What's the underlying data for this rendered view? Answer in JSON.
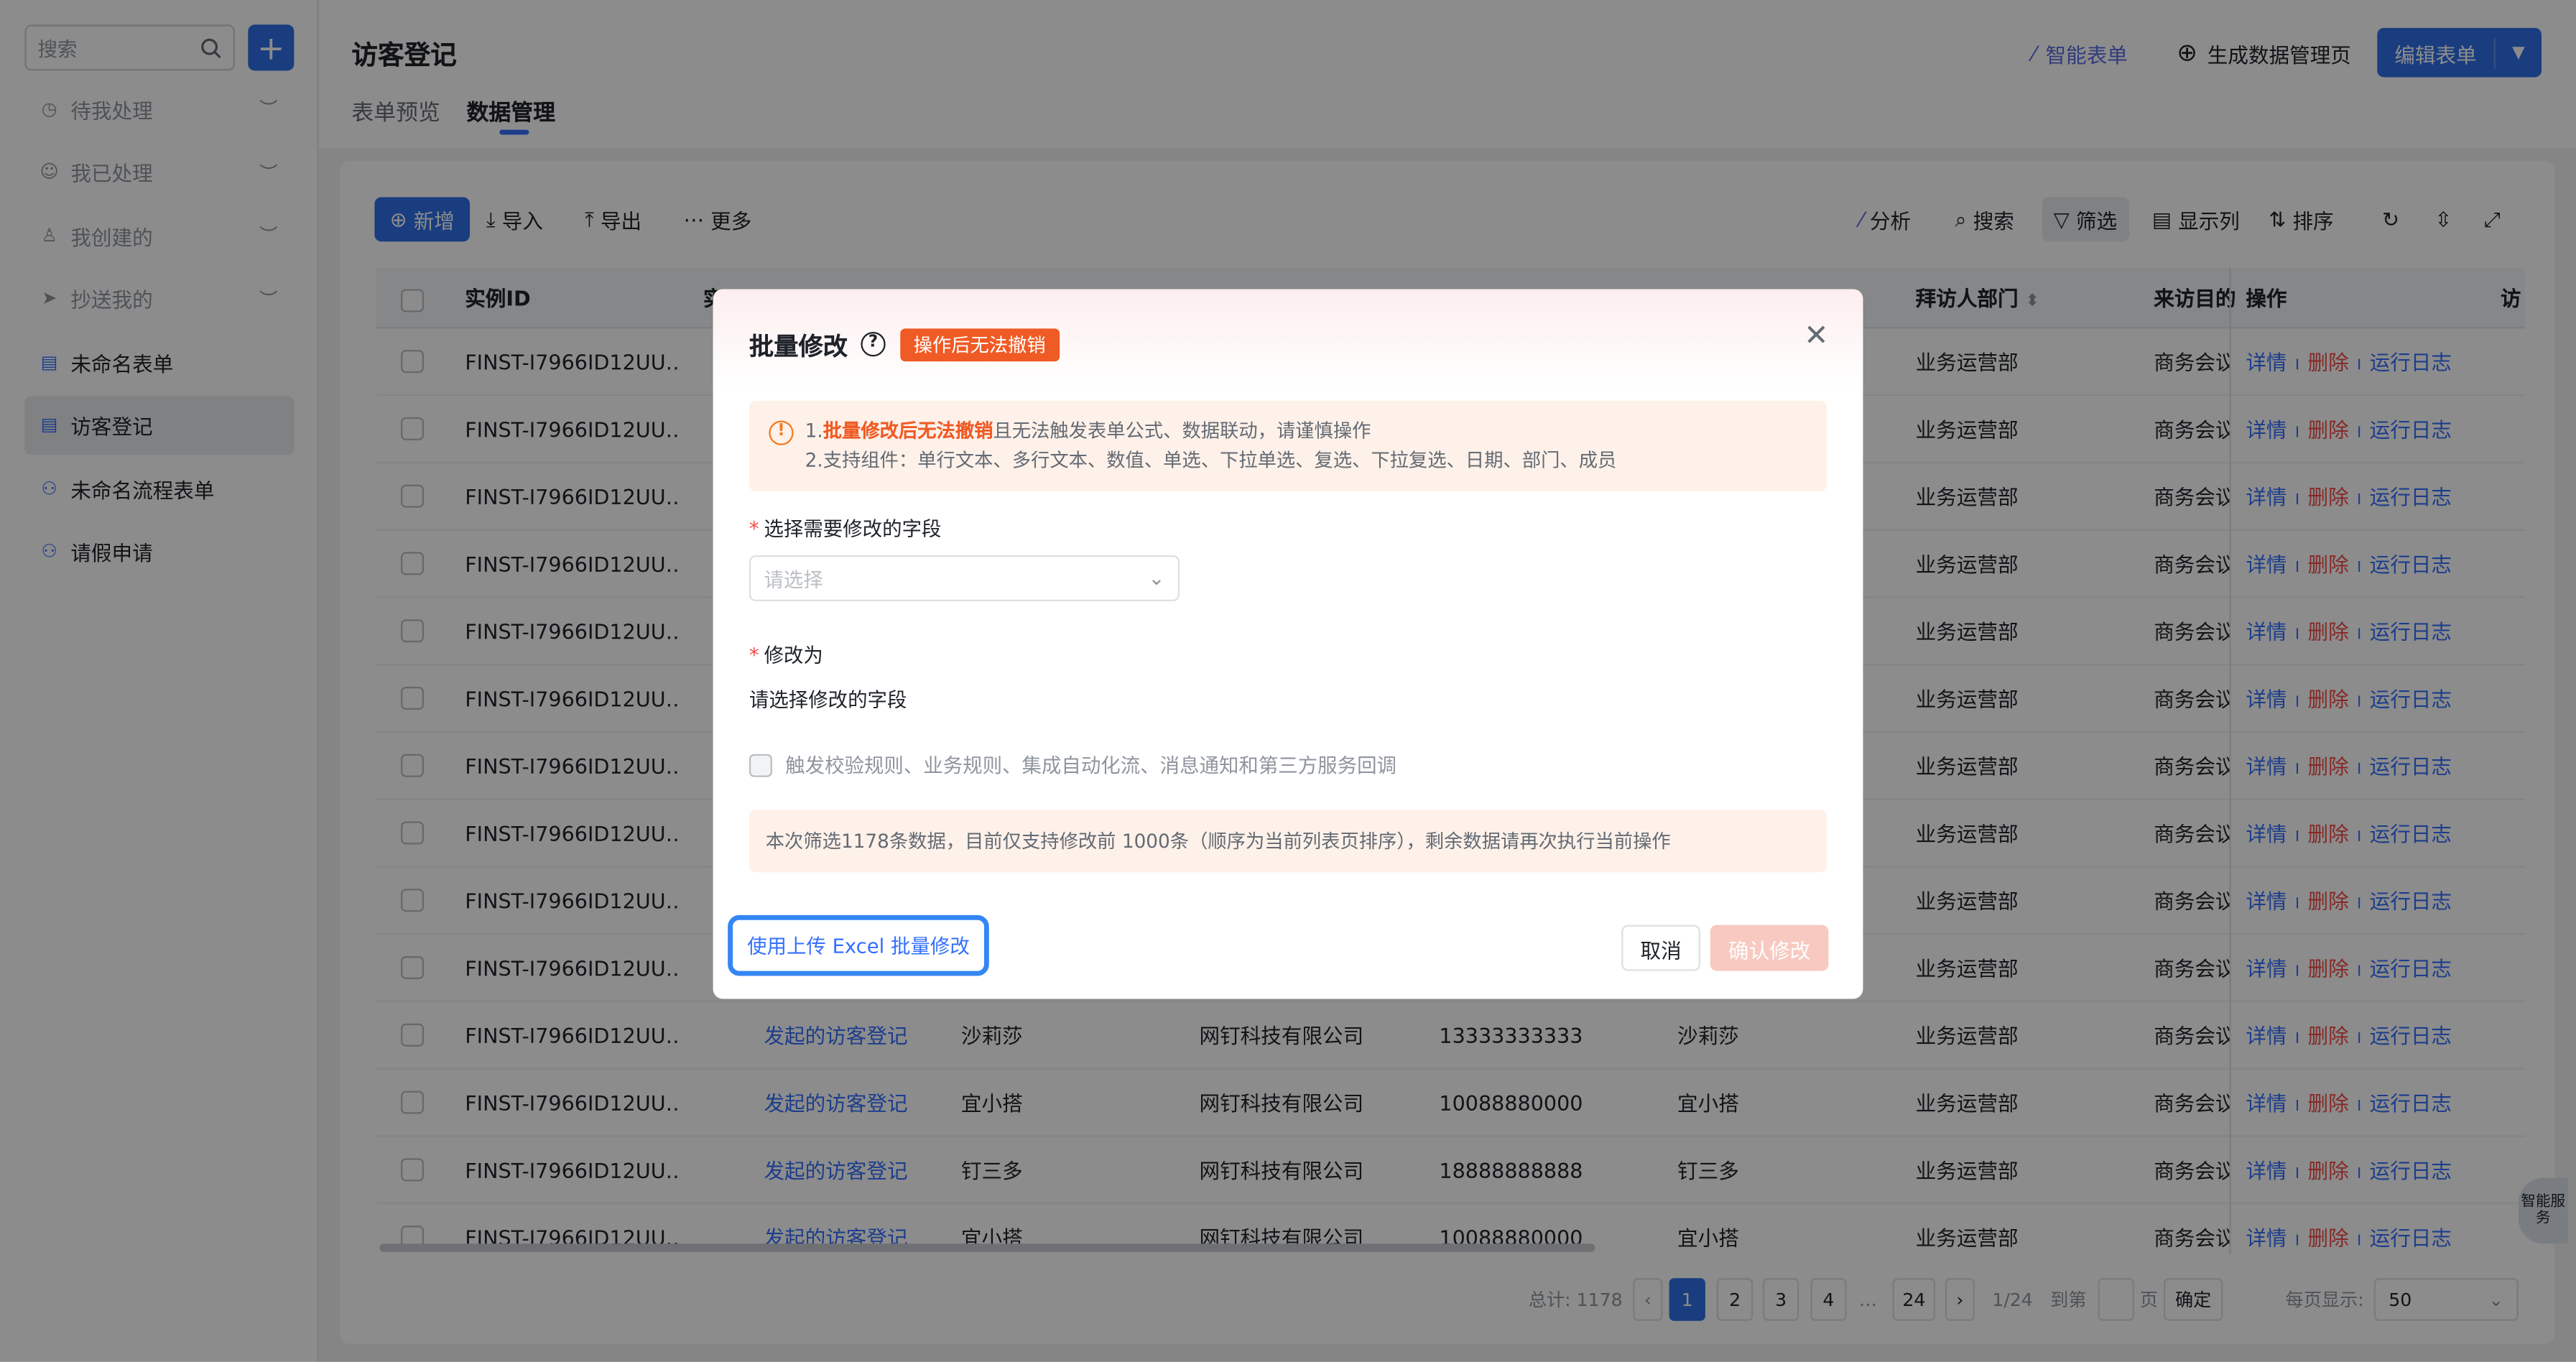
{
  "sidebar": {
    "search_placeholder": "搜索",
    "add_label": "+",
    "items": [
      {
        "label": "待我处理",
        "icon": "clock-icon",
        "type": "system"
      },
      {
        "label": "我已处理",
        "icon": "user-check-icon",
        "type": "system"
      },
      {
        "label": "我创建的",
        "icon": "user-icon",
        "type": "system"
      },
      {
        "label": "抄送我的",
        "icon": "send-icon",
        "type": "system"
      },
      {
        "label": "未命名表单",
        "icon": "form-icon",
        "type": "form"
      },
      {
        "label": "访客登记",
        "icon": "form-icon",
        "type": "form",
        "active": true
      },
      {
        "label": "未命名流程表单",
        "icon": "flow-icon",
        "type": "form"
      },
      {
        "label": "请假申请",
        "icon": "flow-icon",
        "type": "form"
      }
    ]
  },
  "header": {
    "title": "访客登记",
    "tabs": [
      "表单预览",
      "数据管理"
    ],
    "active_tab": "数据管理",
    "smart_form": "智能表单",
    "generate_page": "生成数据管理页",
    "edit_form": "编辑表单"
  },
  "toolbar": {
    "add": "新增",
    "import": "导入",
    "export": "导出",
    "more": "更多",
    "analyze": "分析",
    "search": "搜索",
    "filter": "筛选",
    "columns": "显示列",
    "sort": "排序"
  },
  "table": {
    "headers": [
      "实例ID",
      "实",
      "拜访人部门",
      "来访目的",
      "操作",
      "访"
    ],
    "actions": {
      "detail": "详情",
      "delete": "删除",
      "log": "运行日志",
      "sep": "I"
    },
    "top_rows": [
      {
        "id": "FINST-I7966ID12UU…",
        "dept": "业务运营部",
        "purpose": "商务会议"
      },
      {
        "id": "FINST-I7966ID12UU…",
        "dept": "业务运营部",
        "purpose": "商务会议"
      },
      {
        "id": "FINST-I7966ID12UU…",
        "dept": "业务运营部",
        "purpose": "商务会议"
      },
      {
        "id": "FINST-I7966ID12UU…",
        "dept": "业务运营部",
        "purpose": "商务会议"
      },
      {
        "id": "FINST-I7966ID12UU…",
        "dept": "业务运营部",
        "purpose": "商务会议"
      },
      {
        "id": "FINST-I7966ID12UU…",
        "dept": "业务运营部",
        "purpose": "商务会议"
      },
      {
        "id": "FINST-I7966ID12UU…",
        "dept": "业务运营部",
        "purpose": "商务会议"
      },
      {
        "id": "FINST-I7966ID12UU…",
        "dept": "业务运营部",
        "purpose": "商务会议"
      },
      {
        "id": "FINST-I7966ID12UU…",
        "dept": "业务运营部",
        "purpose": "商务会议"
      },
      {
        "id": "FINST-I7966ID12UU…",
        "dept": "业务运营部",
        "purpose": "商务会议"
      }
    ],
    "bottom_rows": [
      {
        "id": "FINST-I7966ID12UU…",
        "title": "发起的访客登记",
        "name": "沙莉莎",
        "company": "网钉科技有限公司",
        "phone": "13333333333",
        "visitee": "沙莉莎",
        "dept": "业务运营部",
        "purpose": "商务会议"
      },
      {
        "id": "FINST-I7966ID12UU…",
        "title": "发起的访客登记",
        "name": "宜小搭",
        "company": "网钉科技有限公司",
        "phone": "10088880000",
        "visitee": "宜小搭",
        "dept": "业务运营部",
        "purpose": "商务会议"
      },
      {
        "id": "FINST-I7966ID12UU…",
        "title": "发起的访客登记",
        "name": "钉三多",
        "company": "网钉科技有限公司",
        "phone": "18888888888",
        "visitee": "钉三多",
        "dept": "业务运营部",
        "purpose": "商务会议"
      },
      {
        "id": "FINST-I7966ID12UU…",
        "title": "发起的访客登记",
        "name": "宜小搭",
        "company": "网钉科技有限公司",
        "phone": "10088880000",
        "visitee": "宜小搭",
        "dept": "业务运营部",
        "purpose": "商务会议"
      }
    ]
  },
  "pagination": {
    "total": "总计: 1178",
    "pages": [
      "1",
      "2",
      "3",
      "4",
      "…",
      "24"
    ],
    "current": "1",
    "of": "1/24",
    "goto": "到第",
    "page_unit": "页",
    "confirm": "确定",
    "per_page_label": "每页显示:",
    "per_page": "50"
  },
  "smart_assistant": "智能服务",
  "modal": {
    "title": "批量修改",
    "badge": "操作后无法撤销",
    "notice_prefix": "1.",
    "notice_bold": "批量修改后无法撤销",
    "notice_rest": "且无法触发表单公式、数据联动，请谨慎操作",
    "notice_line2": "2.支持组件：单行文本、多行文本、数值、单选、下拉单选、复选、下拉复选、日期、部门、成员",
    "field_label": "选择需要修改的字段",
    "field_placeholder": "请选择",
    "modify_label": "修改为",
    "modify_hint": "请选择修改的字段",
    "trigger_label": "触发校验规则、业务规则、集成自动化流、消息通知和第三方服务回调",
    "info": "本次筛选1178条数据，目前仅支持修改前 1000条（顺序为当前列表页排序），剩余数据请再次执行当前操作",
    "excel_button": "使用上传 Excel 批量修改",
    "cancel": "取消",
    "confirm": "确认修改"
  },
  "colors": {
    "primary": "#2f6fe8",
    "danger": "#f54a45",
    "warn_badge": "#f05a24",
    "highlight_border": "#3486f5"
  }
}
